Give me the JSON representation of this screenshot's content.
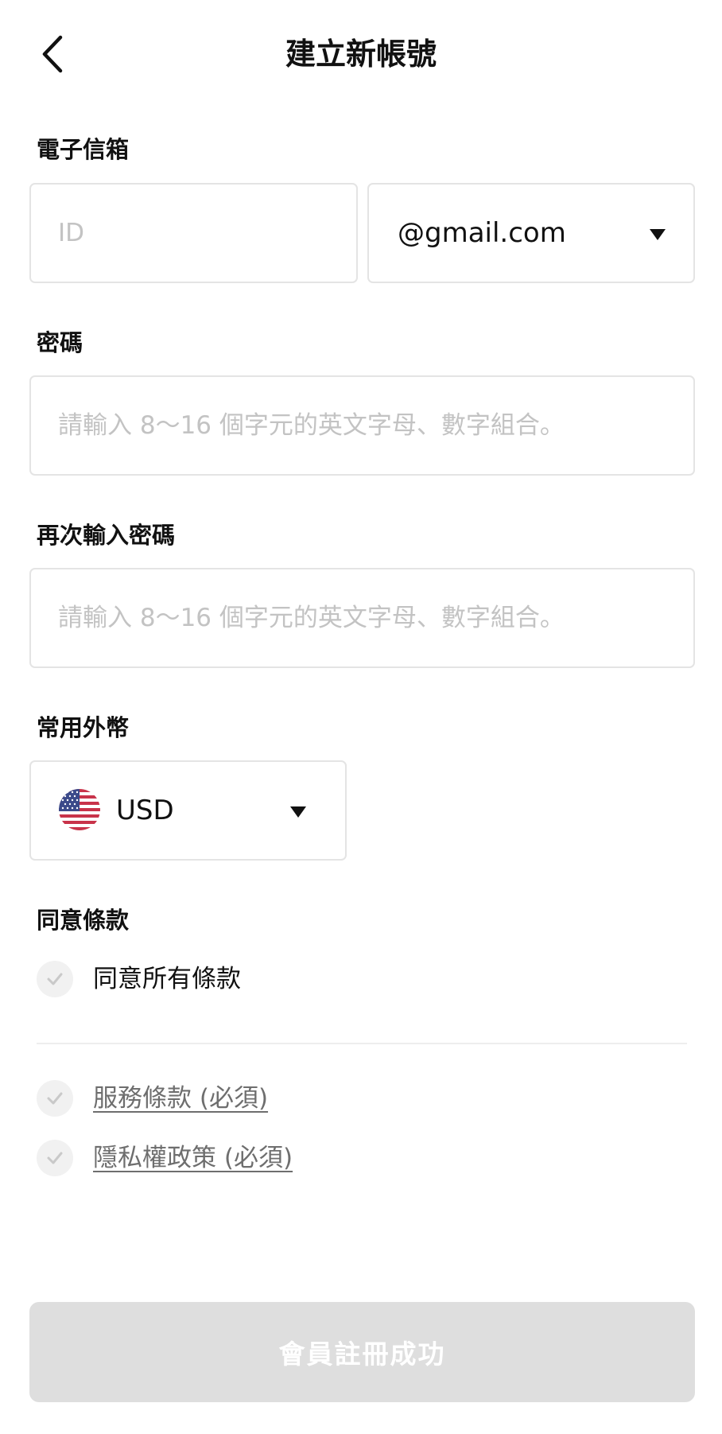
{
  "header": {
    "title": "建立新帳號"
  },
  "email": {
    "label": "電子信箱",
    "id_placeholder": "ID",
    "id_value": "",
    "domain_selected": "@gmail.com"
  },
  "password": {
    "label": "密碼",
    "placeholder": "請輸入 8～16 個字元的英文字母、數字組合。",
    "value": ""
  },
  "password_confirm": {
    "label": "再次輸入密碼",
    "placeholder": "請輸入 8～16 個字元的英文字母、數字組合。",
    "value": ""
  },
  "currency": {
    "label": "常用外幣",
    "selected": "USD",
    "flag_icon": "us-flag-icon"
  },
  "terms": {
    "label": "同意條款",
    "agree_all": "同意所有條款",
    "items": [
      {
        "label": "服務條款 (必須)"
      },
      {
        "label": "隱私權政策 (必須)"
      }
    ]
  },
  "submit": {
    "label": "會員註冊成功"
  },
  "colors": {
    "border": "#e4e4e4",
    "placeholder": "#c3c3c3",
    "button_disabled": "#dedede",
    "check_bg": "#f1f1f1",
    "check_mark": "#c9c9c9",
    "link": "#6e6e6e"
  }
}
